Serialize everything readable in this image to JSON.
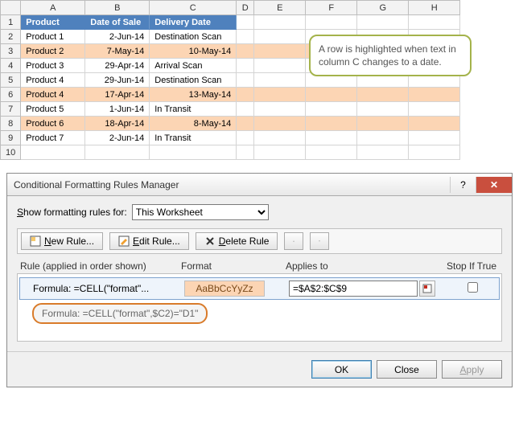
{
  "columns": [
    "",
    "A",
    "B",
    "C",
    "D",
    "E",
    "F",
    "G",
    "H"
  ],
  "headerRow": {
    "a": "Product",
    "b": "Date of Sale",
    "c": "Delivery Date"
  },
  "rows": [
    {
      "n": "1",
      "a": "Product",
      "b": "Date of Sale",
      "c": "Delivery Date",
      "hdr": true
    },
    {
      "n": "2",
      "a": "Product 1",
      "b": "2-Jun-14",
      "c": "Destination Scan"
    },
    {
      "n": "3",
      "a": "Product 2",
      "b": "7-May-14",
      "c": "10-May-14",
      "hl": true,
      "cAlign": "right"
    },
    {
      "n": "4",
      "a": "Product 3",
      "b": "29-Apr-14",
      "c": "Arrival Scan"
    },
    {
      "n": "5",
      "a": "Product 4",
      "b": "29-Jun-14",
      "c": "Destination Scan"
    },
    {
      "n": "6",
      "a": "Product 4",
      "b": "17-Apr-14",
      "c": "13-May-14",
      "hl": true,
      "cAlign": "right"
    },
    {
      "n": "7",
      "a": "Product 5",
      "b": "1-Jun-14",
      "c": "In Transit"
    },
    {
      "n": "8",
      "a": "Product 6",
      "b": "18-Apr-14",
      "c": "8-May-14",
      "hl": true,
      "cAlign": "right"
    },
    {
      "n": "9",
      "a": "Product 7",
      "b": "2-Jun-14",
      "c": "In Transit"
    },
    {
      "n": "10",
      "a": "",
      "b": "",
      "c": ""
    }
  ],
  "callout": "A row is highlighted when text in column C changes to a date.",
  "dialog": {
    "title": "Conditional Formatting Rules Manager",
    "showLabel_pre": "S",
    "showLabel_mid": "how formatting rules for:",
    "scope": "This Worksheet",
    "btnNew_pre": "N",
    "btnNew_post": "ew Rule...",
    "btnEdit_pre": "E",
    "btnEdit_post": "dit Rule...",
    "btnDelete_pre": "D",
    "btnDelete_post": "elete Rule",
    "head_rule": "Rule (applied in order shown)",
    "head_format": "Format",
    "head_applies": "Applies to",
    "head_stop": "Stop If True",
    "rule_text": "Formula: =CELL(\"format\"...",
    "format_preview": "AaBbCcYyZz",
    "applies_value": "=$A$2:$C$9",
    "tooltip": "Formula: =CELL(\"format\",$C2)=\"D1\"",
    "ok": "OK",
    "close": "Close",
    "apply_pre": "A",
    "apply_post": "pply"
  }
}
